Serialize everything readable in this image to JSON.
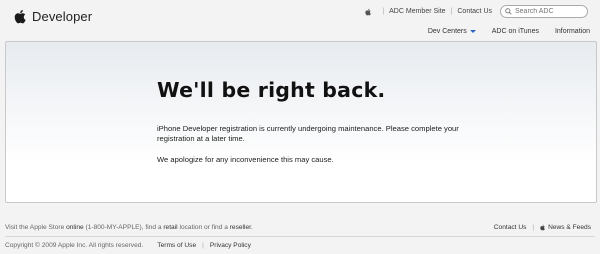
{
  "header": {
    "brand": "Developer",
    "utility_links": [
      "ADC Member Site",
      "Contact Us"
    ],
    "search_placeholder": "Search ADC"
  },
  "subnav": {
    "items": [
      "Dev Centers",
      "ADC on iTunes",
      "Information"
    ]
  },
  "main": {
    "headline": "We'll be right back.",
    "message1": "iPhone Developer registration is currently undergoing maintenance. Please complete your registration at a later time.",
    "message2": "We apologize for any inconvenience this may cause."
  },
  "footer": {
    "store_prefix": "Visit the Apple Store ",
    "store_link": "online",
    "phone": " (1-800-MY-APPLE), find a ",
    "retail_link": "retail",
    "location_text": " location or find a ",
    "reseller_link": "reseller",
    "period": ".",
    "contact": "Contact Us",
    "news": "News & Feeds",
    "copyright": "Copyright © 2009 Apple Inc. All rights reserved.",
    "terms": "Terms of Use",
    "privacy": "Privacy Policy"
  },
  "colors": {
    "accent": "#2a64c4",
    "background": "#f3f3f3",
    "panel_top": "#e7ebef"
  }
}
